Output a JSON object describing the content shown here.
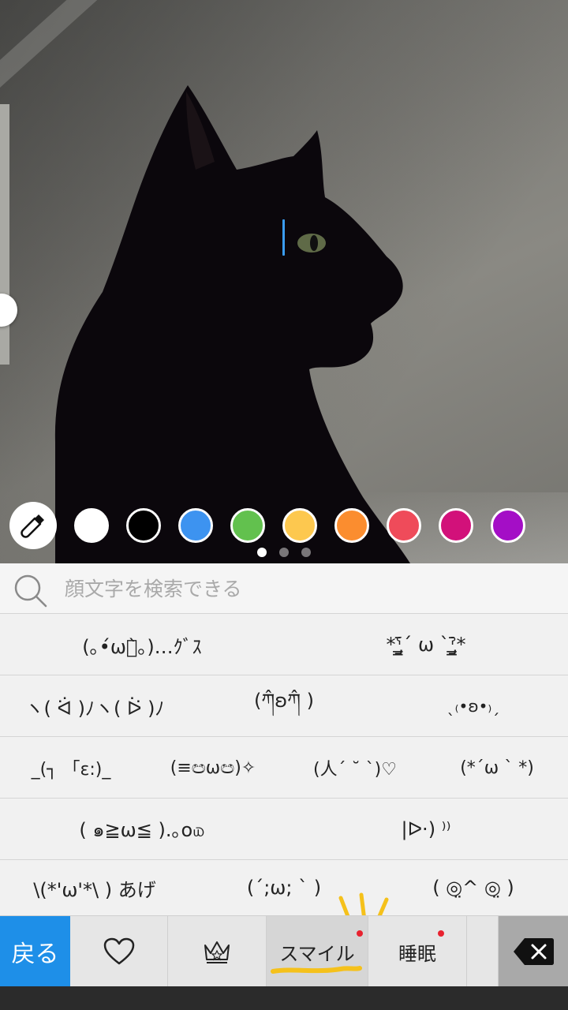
{
  "editor": {
    "colors": [
      "#ffffff",
      "#000000",
      "#3d93f0",
      "#62c14e",
      "#fdc84f",
      "#fb8d2f",
      "#ef4b5a",
      "#d2117a",
      "#a40ec6"
    ],
    "eyedropper_icon": "eyedropper-icon",
    "page_indicator": {
      "count": 3,
      "active": 0
    }
  },
  "search": {
    "placeholder": "顔文字を検索できる",
    "icon": "search-icon"
  },
  "kaomoji_rows": [
    [
      "(｡•́ωก̀｡)…ｸﾞｽ",
      "*ˁ̡̱̲̳̄ˊ ω ˋˀ̡̱̲̳̄*"
    ],
    [
      "ヽ( ᐛ )ﾉヽ( ᐖ )ﾉ",
      "(ཀ̂ʚཀ̂ )",
      "ˎ₍•ʚ•₎ˏ"
    ],
    [
      "_(┐ 「ε:)_",
      "(≡ඏωඏ)✧",
      "(人´ ˘ `)♡",
      "(*´ω ` *)"
    ],
    [
      "( ๑≧ω≦ ).｡o௰",
      "|ᐅ·) ⁾⁾"
    ],
    [
      "\\(*'ω'*\\ ) あげ",
      "(´;ω; ` )",
      "( ◎̤^ ◎̤ )"
    ]
  ],
  "tabs": {
    "back_label": "戻る",
    "favorites_icon": "heart-icon",
    "ranking_icon": "crown-icon",
    "smile_label": "スマイル",
    "sleep_label": "睡眠",
    "delete_icon": "backspace-icon"
  }
}
